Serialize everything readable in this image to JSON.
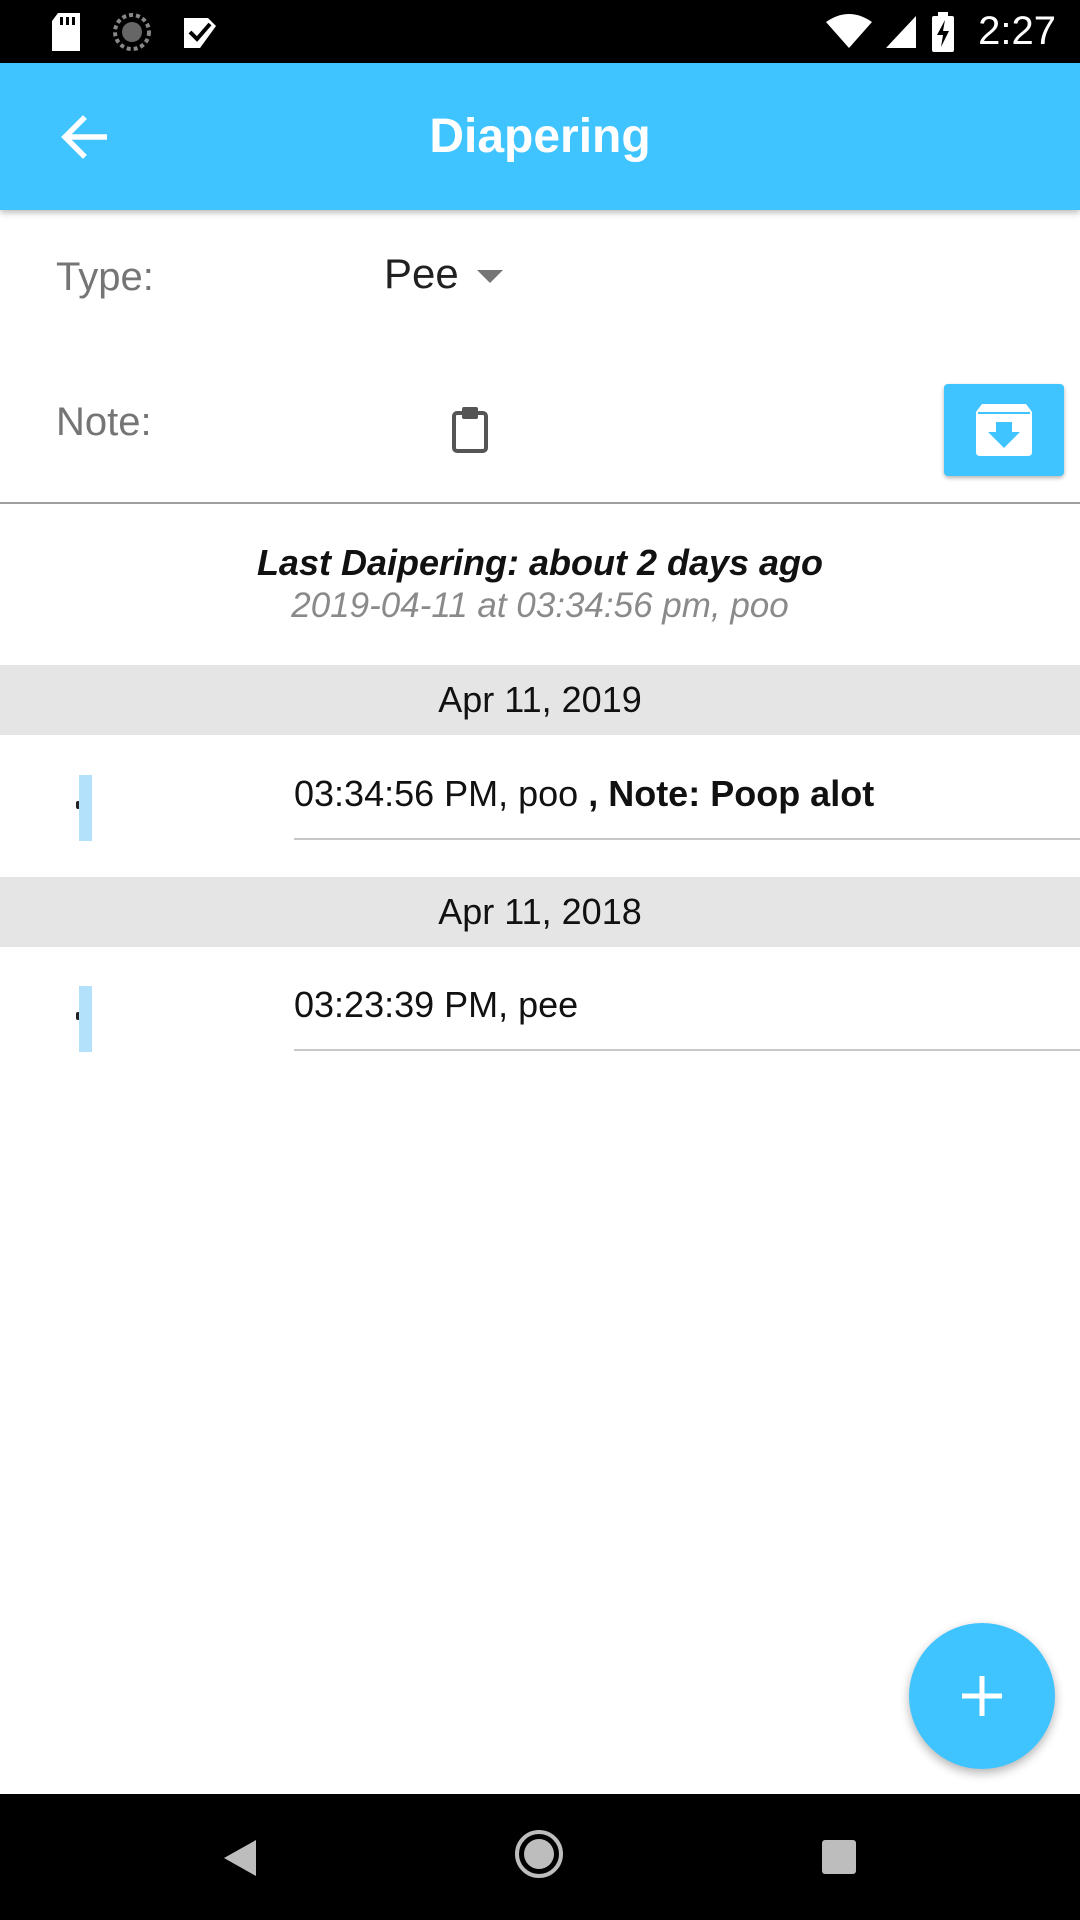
{
  "status_bar": {
    "time": "2:27",
    "icons": [
      "sd-card-icon",
      "sync-icon",
      "check-app-icon",
      "wifi-icon",
      "signal-icon",
      "battery-charging-icon"
    ]
  },
  "app_bar": {
    "title": "Diapering",
    "back_icon": "arrow-back-icon"
  },
  "form": {
    "type_label": "Type:",
    "type_value": "Pee",
    "note_label": "Note:",
    "note_icon": "clipboard-icon",
    "save_icon": "archive-download-icon"
  },
  "last": {
    "title": "Last Daipering: about 2 days ago",
    "subtitle": "2019-04-11 at 03:34:56 pm, poo"
  },
  "groups": [
    {
      "date": "Apr 11, 2019",
      "entries": [
        {
          "text": "03:34:56 PM, poo",
          "note": " , Note: Poop alot"
        }
      ]
    },
    {
      "date": "Apr 11, 2018",
      "entries": [
        {
          "text": "03:23:39 PM, pee",
          "note": ""
        }
      ]
    }
  ],
  "fab": {
    "icon": "add-icon"
  },
  "colors": {
    "primary": "#40C4FF",
    "marker": "#B3E0FA",
    "group_bg": "#E5E5E5"
  }
}
